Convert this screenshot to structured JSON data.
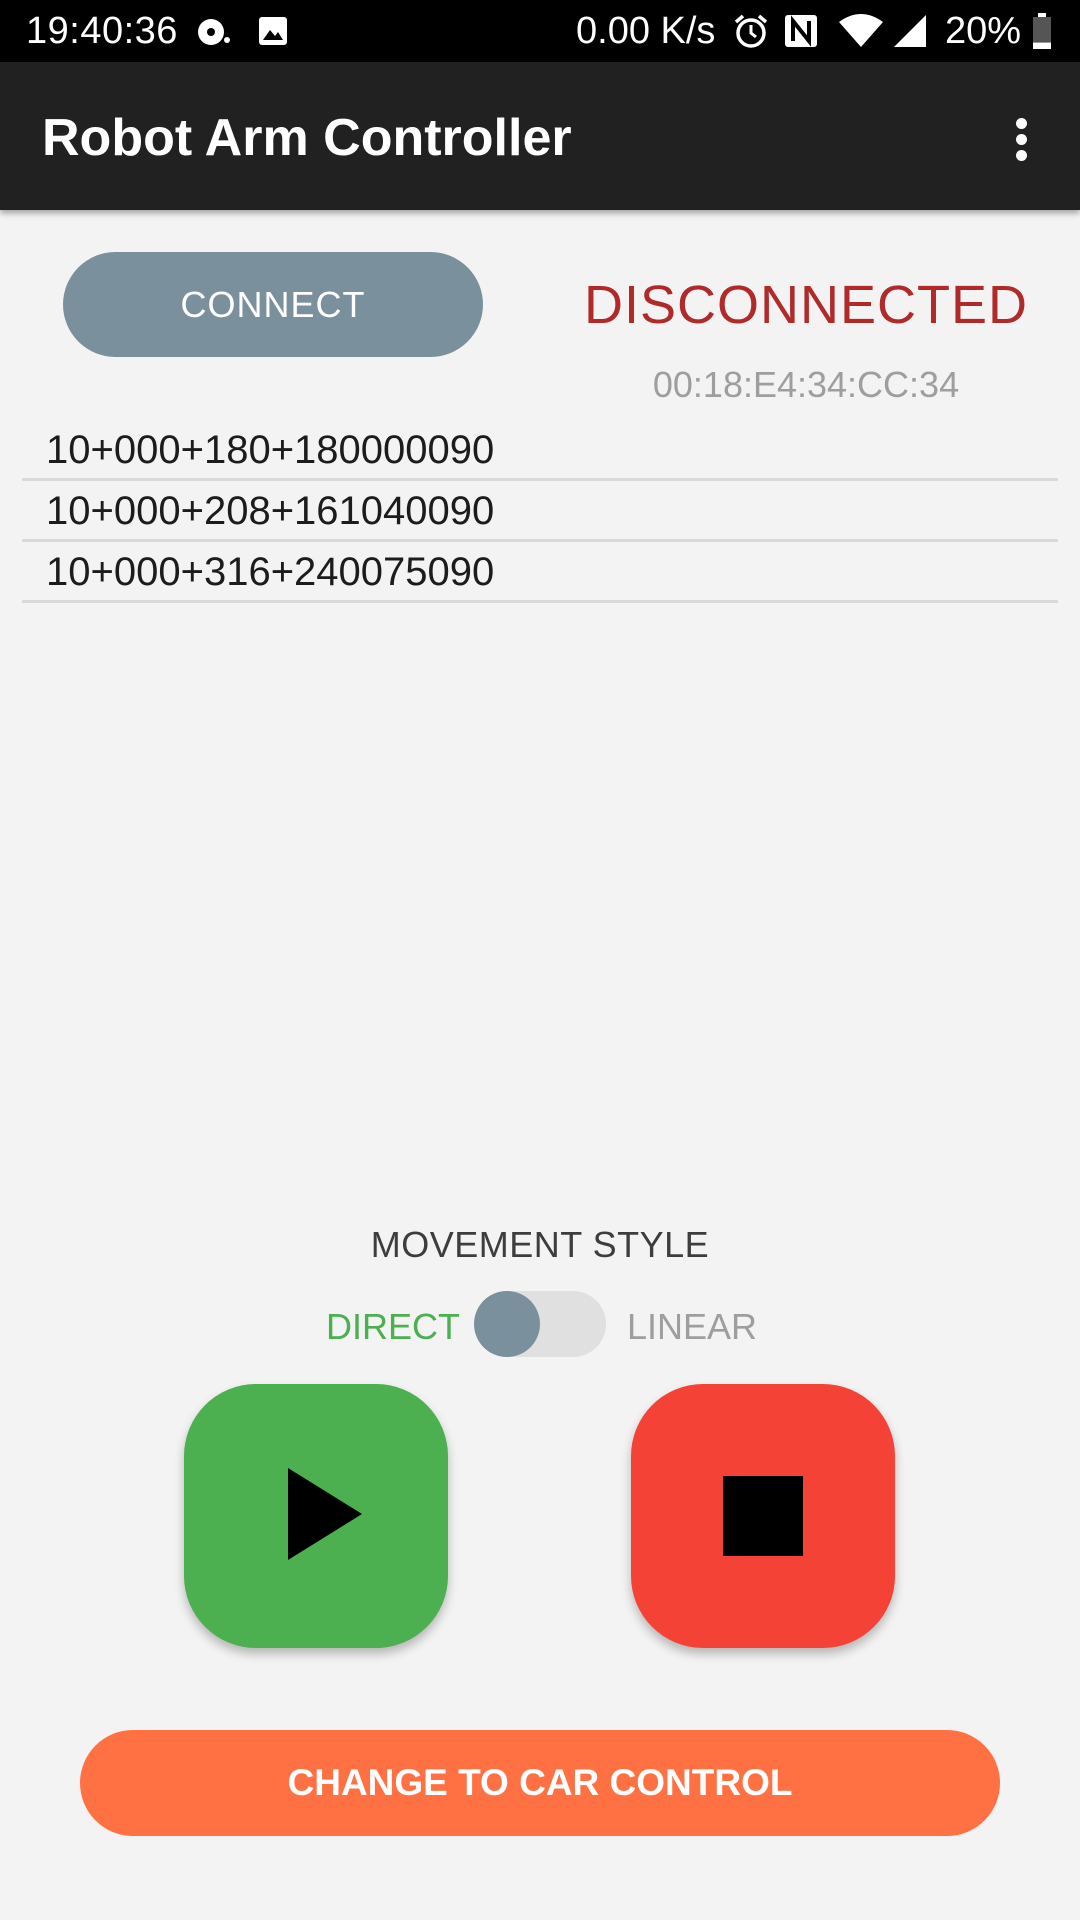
{
  "status_bar": {
    "time": "19:40:36",
    "net_speed": "0.00 K/s",
    "battery": "20%",
    "icons": [
      "notification-icon",
      "image-icon",
      "alarm-icon",
      "nfc-icon",
      "wifi-icon",
      "signal-icon",
      "battery-icon"
    ],
    "battery_level": 0.2
  },
  "app_bar": {
    "title": "Robot Arm Controller",
    "menu_icon": "more-vert-icon"
  },
  "connection": {
    "button_label": "CONNECT",
    "status": "DISCONNECTED",
    "status_color": "#b02a2a",
    "address": "00:18:E4:34:CC:34"
  },
  "commands": [
    "10+000+180+180000090",
    "10+000+208+161040090",
    "10+000+316+240075090"
  ],
  "movement": {
    "label": "MOVEMENT STYLE",
    "option_left": "DIRECT",
    "option_right": "LINEAR",
    "selected": "DIRECT"
  },
  "controls": {
    "play_icon": "play-icon",
    "stop_icon": "stop-icon",
    "play_color": "#4caf50",
    "stop_color": "#f44336"
  },
  "footer": {
    "button_label": "CHANGE TO CAR CONTROL",
    "button_color": "#ff7043"
  }
}
